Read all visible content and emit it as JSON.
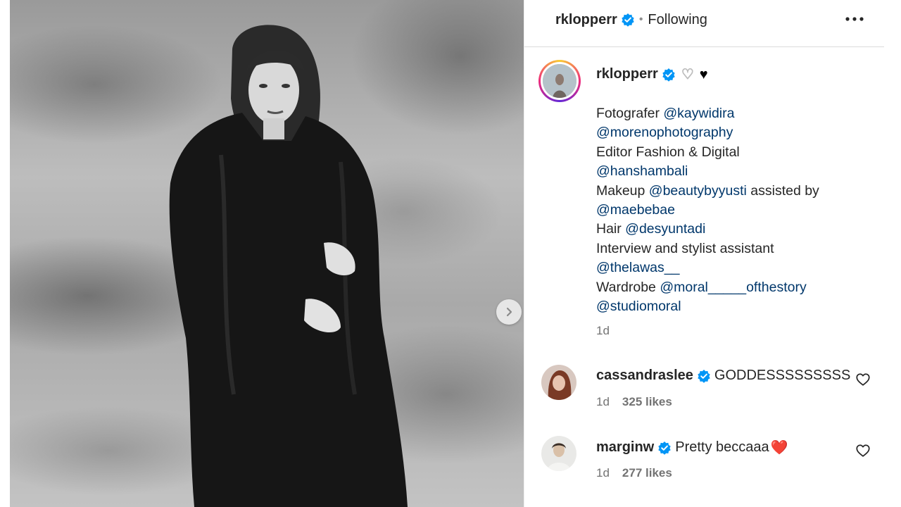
{
  "header": {
    "username": "rklopperr",
    "separator": "•",
    "follow_state": "Following"
  },
  "caption": {
    "username": "rklopperr",
    "hearts": [
      "♡",
      "♥"
    ],
    "lines": [
      [
        {
          "t": "Fotografer "
        },
        {
          "t": "@kaywidira",
          "m": true
        }
      ],
      [
        {
          "t": "@morenophotography",
          "m": true
        }
      ],
      [
        {
          "t": "Editor Fashion & Digital"
        }
      ],
      [
        {
          "t": "@hanshambali",
          "m": true
        }
      ],
      [
        {
          "t": "Makeup "
        },
        {
          "t": "@beautybyyusti",
          "m": true
        },
        {
          "t": " assisted by"
        }
      ],
      [
        {
          "t": "@maebebae",
          "m": true
        }
      ],
      [
        {
          "t": "Hair "
        },
        {
          "t": "@desyuntadi",
          "m": true
        }
      ],
      [
        {
          "t": "Interview and stylist assistant"
        }
      ],
      [
        {
          "t": "@thelawas__",
          "m": true
        }
      ],
      [
        {
          "t": "Wardrobe "
        },
        {
          "t": "@moral_____ofthestory",
          "m": true
        }
      ],
      [
        {
          "t": "@studiomoral",
          "m": true
        }
      ]
    ],
    "time": "1d"
  },
  "comments": [
    {
      "username": "cassandraslee",
      "text": "GODDESSSSSSSSS",
      "time": "1d",
      "likes": "325 likes"
    },
    {
      "username": "marginw",
      "text": "Pretty beccaaa",
      "emoji": "❤️",
      "time": "1d",
      "likes": "277 likes"
    }
  ],
  "colors": {
    "verified": "#0095f6",
    "mention": "#00376b",
    "meta": "#737373",
    "heart_red": "#ed4956"
  },
  "icons": {
    "verified": "verified-badge-icon",
    "more": "more-horizontal-icon",
    "next": "chevron-right-icon",
    "like": "heart-outline-icon"
  }
}
